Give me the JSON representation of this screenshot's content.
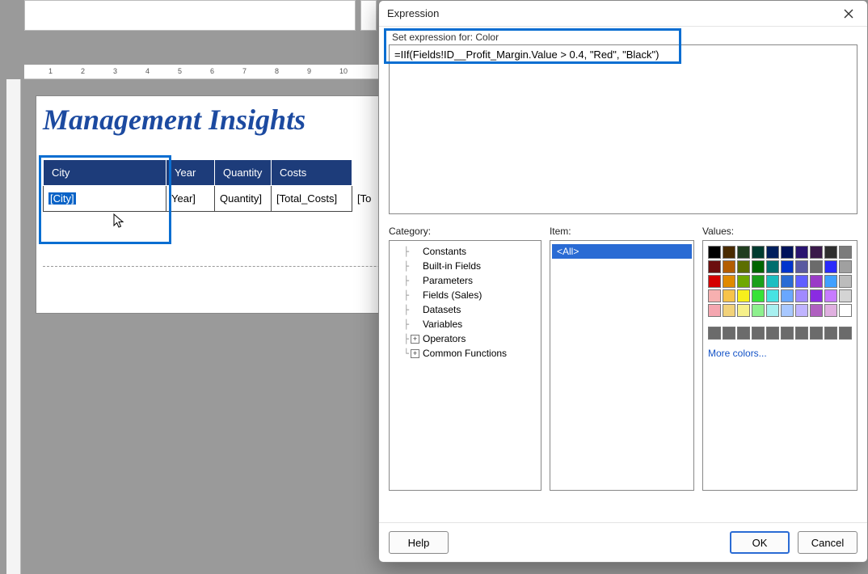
{
  "report": {
    "title": "Management Insights",
    "columns": [
      "City",
      "Year",
      "Quantity",
      "Costs"
    ],
    "fields": [
      "[City]",
      "Year]",
      "Quantity]",
      "[Total_Costs]",
      "[To"
    ]
  },
  "ruler_h": [
    "1",
    "2",
    "3",
    "4",
    "5",
    "6",
    "7",
    "8",
    "9",
    "10"
  ],
  "dialog": {
    "title": "Expression",
    "label": "Set expression for: Color",
    "expression": "=IIf(Fields!ID__Profit_Margin.Value > 0.4, \"Red\", \"Black\")",
    "category_heading": "Category:",
    "item_heading": "Item:",
    "values_heading": "Values:",
    "categories": [
      {
        "label": "Constants",
        "exp": ""
      },
      {
        "label": "Built-in Fields",
        "exp": ""
      },
      {
        "label": "Parameters",
        "exp": ""
      },
      {
        "label": "Fields (Sales)",
        "exp": ""
      },
      {
        "label": "Datasets",
        "exp": ""
      },
      {
        "label": "Variables",
        "exp": ""
      },
      {
        "label": "Operators",
        "exp": "+"
      },
      {
        "label": "Common Functions",
        "exp": "+"
      }
    ],
    "items": [
      "<All>"
    ],
    "swatches_main": [
      "#000000",
      "#4a2b00",
      "#203d1f",
      "#003b2f",
      "#001e5c",
      "#00125a",
      "#2a1470",
      "#3a1a4a",
      "#2f2f2f",
      "#7c7c7c",
      "#6b0e0e",
      "#b35d00",
      "#5c6e00",
      "#006400",
      "#006d6d",
      "#0033cc",
      "#5a5aa0",
      "#6b6b6b",
      "#2b2bfb",
      "#a0a0a0",
      "#d40000",
      "#e08a00",
      "#6fa800",
      "#1ca01c",
      "#1cbec1",
      "#2a6bd4",
      "#6060ff",
      "#9a3bc7",
      "#3fa0ff",
      "#bcbcbc",
      "#f7b0b0",
      "#f7c34a",
      "#f7ef1c",
      "#37e237",
      "#47e3e3",
      "#69a7ff",
      "#a08aff",
      "#8a2be2",
      "#c77bff",
      "#d4d4d4",
      "#f5a6b0",
      "#f2d27a",
      "#f6f08a",
      "#8ef08e",
      "#a8f0f0",
      "#a8c8ff",
      "#c0b4ff",
      "#b060c0",
      "#e0b0e0",
      "#ffffff"
    ],
    "swatches_recent": [
      "#6b6b6b",
      "#6b6b6b",
      "#6b6b6b",
      "#6b6b6b",
      "#6b6b6b",
      "#6b6b6b",
      "#6b6b6b",
      "#6b6b6b",
      "#6b6b6b",
      "#6b6b6b"
    ],
    "more_colors": "More colors...",
    "help": "Help",
    "ok": "OK",
    "cancel": "Cancel"
  }
}
